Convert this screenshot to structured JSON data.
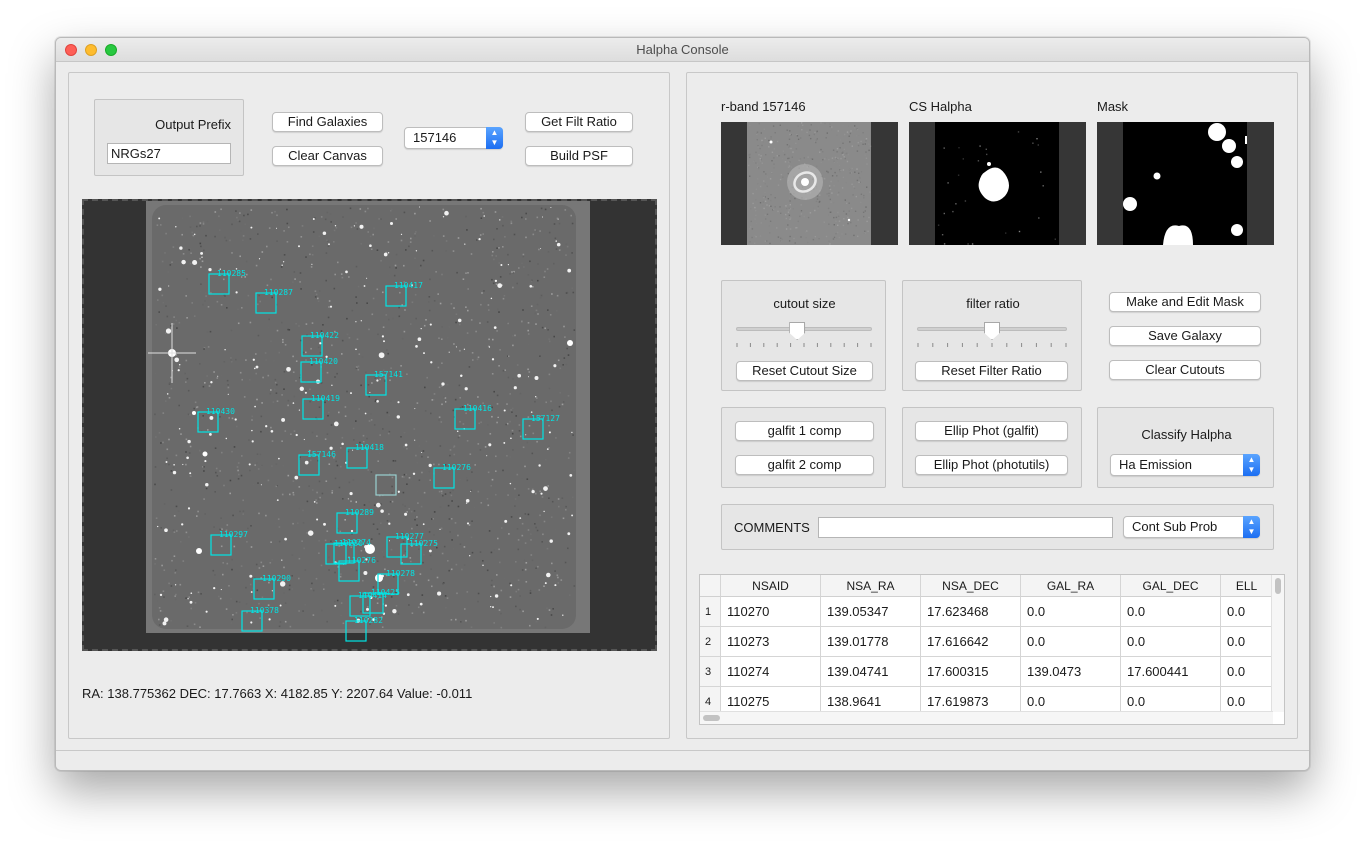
{
  "window": {
    "title": "Halpha Console"
  },
  "left": {
    "output_prefix_label": "Output Prefix",
    "output_prefix_value": "NRGs27",
    "find_galaxies": "Find Galaxies",
    "clear_canvas": "Clear Canvas",
    "galaxy_select": "157146",
    "get_filt_ratio": "Get Filt Ratio",
    "build_psf": "Build PSF",
    "status": "RA: 138.775362  DEC: 17.7663  X: 4182.85  Y: 2207.64  Value: -0.011"
  },
  "markers": [
    {
      "id": "110285"
    },
    {
      "id": "110287"
    },
    {
      "id": "110417"
    },
    {
      "id": "110422"
    },
    {
      "id": "110420"
    },
    {
      "id": "157141"
    },
    {
      "id": "110419"
    },
    {
      "id": "110430"
    },
    {
      "id": "110416"
    },
    {
      "id": "157127"
    },
    {
      "id": "157146"
    },
    {
      "id": "110418"
    },
    {
      "id": "110276"
    },
    {
      "id": "110289"
    },
    {
      "id": "110277"
    },
    {
      "id": "110297"
    },
    {
      "id": "110275"
    },
    {
      "id": "110274"
    },
    {
      "id": "110278"
    },
    {
      "id": "110290"
    },
    {
      "id": "110425"
    },
    {
      "id": "110378"
    },
    {
      "id": "110282"
    },
    {
      "id": "110230"
    },
    {
      "id": "110276"
    },
    {
      "id": "110414"
    }
  ],
  "cutouts": {
    "rband_title": "r-band 157146",
    "halpha_title": "CS Halpha",
    "mask_title": "Mask"
  },
  "controls": {
    "cutout_size_label": "cutout size",
    "cutout_size_value": 0.45,
    "reset_cutout": "Reset Cutout Size",
    "filter_ratio_label": "filter ratio",
    "filter_ratio_value": 0.5,
    "reset_filter": "Reset Filter Ratio",
    "make_mask": "Make and Edit Mask",
    "save_galaxy": "Save Galaxy",
    "clear_cutouts": "Clear Cutouts",
    "galfit1": "galfit 1 comp",
    "galfit2": "galfit 2 comp",
    "ellip_galfit": "Ellip Phot (galfit)",
    "ellip_photutils": "Ellip Phot (photutils)",
    "classify_label": "Classify Halpha",
    "classify_value": "Ha Emission",
    "comments_label": "COMMENTS",
    "comments_value": "",
    "comment_flag": "Cont Sub Prob"
  },
  "table": {
    "columns": [
      "NSAID",
      "NSA_RA",
      "NSA_DEC",
      "GAL_RA",
      "GAL_DEC",
      "ELL"
    ],
    "rows": [
      {
        "n": "1",
        "cells": [
          "110270",
          "139.05347",
          "17.623468",
          "0.0",
          "0.0",
          "0.0"
        ]
      },
      {
        "n": "2",
        "cells": [
          "110273",
          "139.01778",
          "17.616642",
          "0.0",
          "0.0",
          "0.0"
        ]
      },
      {
        "n": "3",
        "cells": [
          "110274",
          "139.04741",
          "17.600315",
          "139.0473",
          "17.600441",
          "0.0"
        ]
      },
      {
        "n": "4",
        "cells": [
          "110275",
          "138.9641",
          "17.619873",
          "0.0",
          "0.0",
          "0.0"
        ]
      }
    ]
  },
  "colors": {
    "marker": "#00e5e5",
    "accent": "#1c6ef2",
    "canvas_border": "#333333"
  }
}
